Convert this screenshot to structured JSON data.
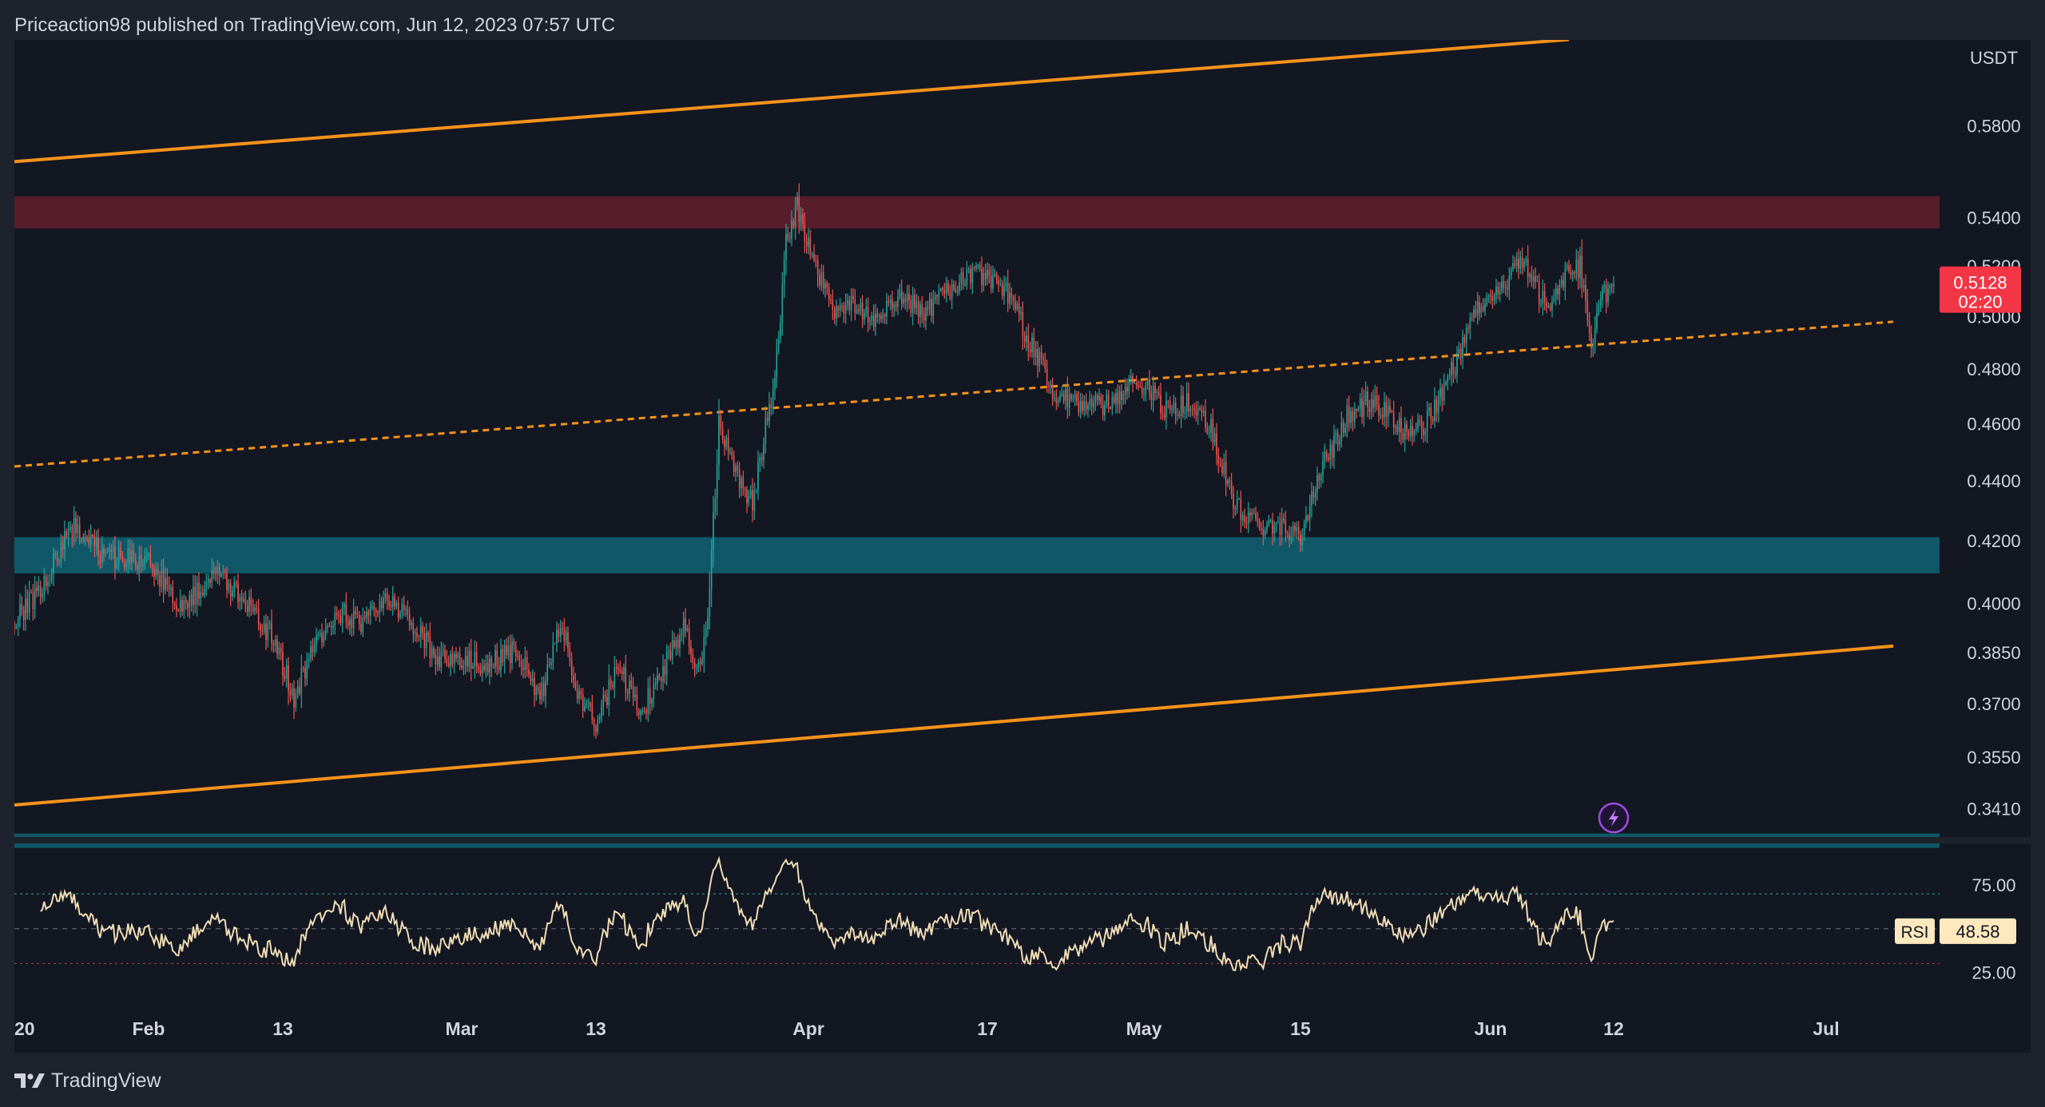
{
  "header": {
    "publisher_text": "Priceaction98 published on TradingView.com, Jun 12, 2023 07:57 UTC"
  },
  "footer": {
    "brand": "TradingView"
  },
  "colors": {
    "background": "#131722",
    "frame": "#1e222d",
    "up": "#26a69a",
    "down": "#ef5350",
    "channel": "#f7931a",
    "resistance_zone": "#5b1d2c",
    "support_zone": "#105b6b",
    "rsi_line": "#efdcb4",
    "last_price_bg": "#f23645",
    "text": "#d1d4dc",
    "rsi_label_bg": "#fde9bd"
  },
  "icons": {
    "alert": "lightning-icon",
    "logo": "tradingview-logo-icon"
  },
  "chart_data": {
    "type": "candlestick",
    "symbol_quote": "USDT",
    "x_range": [
      "2023-01-20",
      "2023-07-12"
    ],
    "y_axis": {
      "scale": "log",
      "range": [
        0.334,
        0.62
      ],
      "unit_label": "USDT",
      "tick_labels": [
        "0.5800",
        "0.5400",
        "0.5200",
        "0.5000",
        "0.4800",
        "0.4600",
        "0.4400",
        "0.4200",
        "0.4000",
        "0.3850",
        "0.3700",
        "0.3550",
        "0.3410"
      ]
    },
    "x_axis": {
      "tick_labels": [
        {
          "date": "2023-01-20",
          "label": "20"
        },
        {
          "date": "2023-02-01",
          "label": "Feb"
        },
        {
          "date": "2023-02-13",
          "label": "13"
        },
        {
          "date": "2023-03-01",
          "label": "Mar"
        },
        {
          "date": "2023-03-13",
          "label": "13"
        },
        {
          "date": "2023-04-01",
          "label": "Apr"
        },
        {
          "date": "2023-04-17",
          "label": "17"
        },
        {
          "date": "2023-05-01",
          "label": "May"
        },
        {
          "date": "2023-05-15",
          "label": "15"
        },
        {
          "date": "2023-06-01",
          "label": "Jun"
        },
        {
          "date": "2023-06-12",
          "label": "12"
        },
        {
          "date": "2023-07-01",
          "label": "Jul"
        }
      ]
    },
    "last_price": {
      "value": "0.5128",
      "countdown": "02:20"
    },
    "price_anchors": [
      [
        "2023-01-20",
        0.394
      ],
      [
        "2023-01-23",
        0.408
      ],
      [
        "2023-01-25",
        0.425
      ],
      [
        "2023-01-28",
        0.415
      ],
      [
        "2023-02-01",
        0.413
      ],
      [
        "2023-02-04",
        0.398
      ],
      [
        "2023-02-07",
        0.411
      ],
      [
        "2023-02-09",
        0.403
      ],
      [
        "2023-02-12",
        0.39
      ],
      [
        "2023-02-14",
        0.372
      ],
      [
        "2023-02-16",
        0.388
      ],
      [
        "2023-02-18",
        0.398
      ],
      [
        "2023-02-20",
        0.393
      ],
      [
        "2023-02-22",
        0.402
      ],
      [
        "2023-02-24",
        0.396
      ],
      [
        "2023-02-27",
        0.383
      ],
      [
        "2023-03-01",
        0.383
      ],
      [
        "2023-03-03",
        0.381
      ],
      [
        "2023-03-06",
        0.386
      ],
      [
        "2023-03-08",
        0.371
      ],
      [
        "2023-03-10",
        0.395
      ],
      [
        "2023-03-11",
        0.376
      ],
      [
        "2023-03-13",
        0.364
      ],
      [
        "2023-03-15",
        0.381
      ],
      [
        "2023-03-17",
        0.367
      ],
      [
        "2023-03-19",
        0.38
      ],
      [
        "2023-03-21",
        0.393
      ],
      [
        "2023-03-22",
        0.378
      ],
      [
        "2023-03-23",
        0.395
      ],
      [
        "2023-03-24",
        0.46
      ],
      [
        "2023-03-25",
        0.447
      ],
      [
        "2023-03-27",
        0.432
      ],
      [
        "2023-03-28",
        0.455
      ],
      [
        "2023-03-29",
        0.475
      ],
      [
        "2023-03-30",
        0.53
      ],
      [
        "2023-03-31",
        0.545
      ],
      [
        "2023-04-01",
        0.528
      ],
      [
        "2023-04-03",
        0.503
      ],
      [
        "2023-04-05",
        0.505
      ],
      [
        "2023-04-07",
        0.5
      ],
      [
        "2023-04-09",
        0.508
      ],
      [
        "2023-04-11",
        0.502
      ],
      [
        "2023-04-13",
        0.507
      ],
      [
        "2023-04-15",
        0.517
      ],
      [
        "2023-04-17",
        0.517
      ],
      [
        "2023-04-19",
        0.507
      ],
      [
        "2023-04-21",
        0.488
      ],
      [
        "2023-04-23",
        0.471
      ],
      [
        "2023-04-25",
        0.468
      ],
      [
        "2023-04-27",
        0.466
      ],
      [
        "2023-04-29",
        0.472
      ],
      [
        "2023-05-01",
        0.475
      ],
      [
        "2023-05-03",
        0.465
      ],
      [
        "2023-05-05",
        0.468
      ],
      [
        "2023-05-07",
        0.458
      ],
      [
        "2023-05-09",
        0.432
      ],
      [
        "2023-05-11",
        0.425
      ],
      [
        "2023-05-13",
        0.424
      ],
      [
        "2023-05-15",
        0.422
      ],
      [
        "2023-05-17",
        0.445
      ],
      [
        "2023-05-19",
        0.462
      ],
      [
        "2023-05-21",
        0.468
      ],
      [
        "2023-05-23",
        0.463
      ],
      [
        "2023-05-25",
        0.455
      ],
      [
        "2023-05-27",
        0.465
      ],
      [
        "2023-05-29",
        0.483
      ],
      [
        "2023-05-31",
        0.505
      ],
      [
        "2023-06-02",
        0.513
      ],
      [
        "2023-06-04",
        0.522
      ],
      [
        "2023-06-06",
        0.503
      ],
      [
        "2023-06-08",
        0.519
      ],
      [
        "2023-06-09",
        0.52
      ],
      [
        "2023-06-10",
        0.488
      ],
      [
        "2023-06-11",
        0.508
      ],
      [
        "2023-06-12",
        0.5128
      ]
    ],
    "rsi": {
      "name": "RSI",
      "current": "48.58",
      "upper_band": 70,
      "middle_band": 50,
      "lower_band": 30,
      "range": [
        10,
        98
      ],
      "tick_labels": [
        "75.00",
        "25.00"
      ]
    },
    "drawings": {
      "channel_upper": {
        "start": [
          "2023-01-20",
          0.564
        ],
        "end": [
          "2023-06-08",
          0.6202
        ],
        "style": "solid"
      },
      "channel_lower": {
        "start": [
          "2023-01-20",
          0.342
        ],
        "end": [
          "2023-07-07",
          0.387
        ],
        "style": "solid"
      },
      "channel_mid": {
        "start": [
          "2023-01-20",
          0.445
        ],
        "end": [
          "2023-07-07",
          0.498
        ],
        "style": "dashed"
      },
      "resistance_zone": {
        "top": 0.549,
        "bottom": 0.5355
      },
      "support_zone": {
        "top": 0.4212,
        "bottom": 0.4095
      },
      "lower_zone": {
        "top": 0.3345,
        "bottom": 0.332
      }
    }
  }
}
